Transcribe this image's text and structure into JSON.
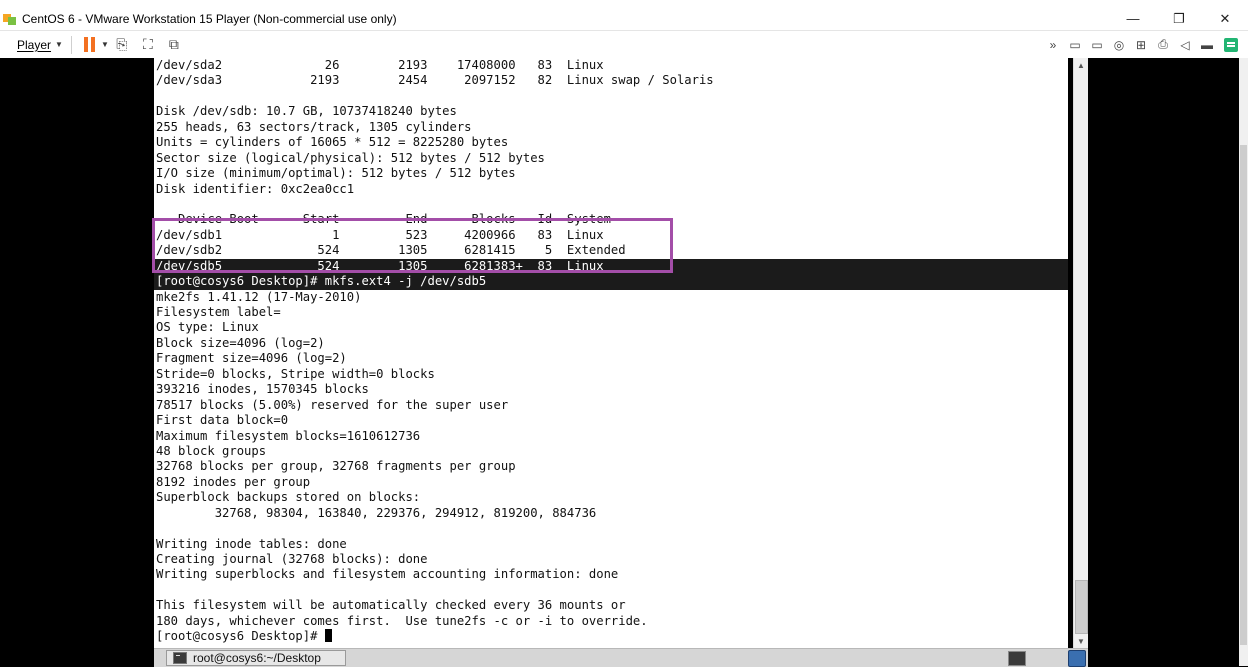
{
  "window": {
    "title": "CentOS 6 - VMware Workstation 15 Player (Non-commercial use only)",
    "minimize": "—",
    "restore": "❐",
    "close": "✕"
  },
  "toolbar": {
    "player_label": "Player",
    "left_icons": [
      "send-ctrl-alt-del-icon",
      "fullscreen-icon",
      "unity-icon"
    ],
    "right_icons": [
      "fast-forward-icon",
      "hdd-icon",
      "hdd2-icon",
      "cd-icon",
      "network-icon",
      "printer-icon",
      "sound-icon",
      "usb-icon",
      "message-log-icon"
    ]
  },
  "terminal": {
    "lines": [
      "/dev/sda2              26        2193    17408000   83  Linux",
      "/dev/sda3            2193        2454     2097152   82  Linux swap / Solaris",
      "",
      "Disk /dev/sdb: 10.7 GB, 10737418240 bytes",
      "255 heads, 63 sectors/track, 1305 cylinders",
      "Units = cylinders of 16065 * 512 = 8225280 bytes",
      "Sector size (logical/physical): 512 bytes / 512 bytes",
      "I/O size (minimum/optimal): 512 bytes / 512 bytes",
      "Disk identifier: 0xc2ea0cc1",
      "",
      "   Device Boot      Start         End      Blocks   Id  System",
      "/dev/sdb1               1         523     4200966   83  Linux",
      "/dev/sdb2             524        1305     6281415    5  Extended",
      "/dev/sdb5             524        1305     6281383+  83  Linux",
      "[root@cosys6 Desktop]# mkfs.ext4 -j /dev/sdb5",
      "mke2fs 1.41.12 (17-May-2010)",
      "Filesystem label=",
      "OS type: Linux",
      "Block size=4096 (log=2)",
      "Fragment size=4096 (log=2)",
      "Stride=0 blocks, Stripe width=0 blocks",
      "393216 inodes, 1570345 blocks",
      "78517 blocks (5.00%) reserved for the super user",
      "First data block=0",
      "Maximum filesystem blocks=1610612736",
      "48 block groups",
      "32768 blocks per group, 32768 fragments per group",
      "8192 inodes per group",
      "Superblock backups stored on blocks:",
      "        32768, 98304, 163840, 229376, 294912, 819200, 884736",
      "",
      "Writing inode tables: done",
      "Creating journal (32768 blocks): done",
      "Writing superblocks and filesystem accounting information: done",
      "",
      "This filesystem will be automatically checked every 36 mounts or",
      "180 days, whichever comes first.  Use tune2fs -c or -i to override.",
      "[root@cosys6 Desktop]# "
    ],
    "highlighted_line_indices": [
      13,
      14
    ],
    "strike_line_index": 10
  },
  "guest_taskbar": {
    "window_button_label": "root@cosys6:~/Desktop"
  },
  "colors": {
    "annotation_box": "#a34ea8",
    "pause_icon": "#f37021",
    "note_icon": "#22b573"
  }
}
